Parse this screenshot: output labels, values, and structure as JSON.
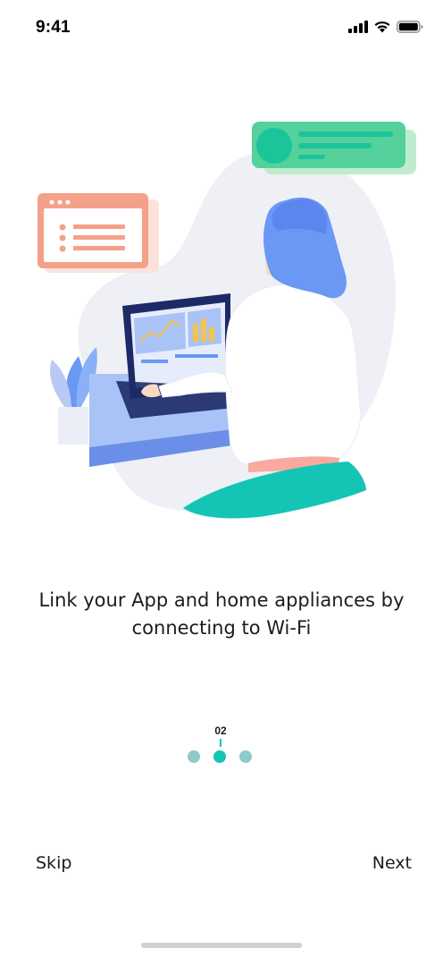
{
  "status_bar": {
    "time": "9:41",
    "icons": [
      "signal-bars-icon",
      "wifi-icon",
      "battery-icon"
    ]
  },
  "illustration": {
    "subject": "onboarding-illustration",
    "colors": {
      "blob": "#eef0f5",
      "accent": "#14c4b4",
      "card_green": "#55d19b",
      "window_salmon": "#f5a089",
      "hair_blue": "#6b97f5",
      "desk_blue": "#a9c3f7"
    }
  },
  "onboarding": {
    "caption_line1": "Link your App and home appliances by",
    "caption_line2": "connecting to Wi-Fi",
    "page_number": "02",
    "current_page": 2,
    "total_pages": 3
  },
  "actions": {
    "skip_label": "Skip",
    "next_label": "Next"
  },
  "colors": {
    "accent": "#14c4b4",
    "dot_inactive": "#8ecac9",
    "text": "#1c1c1c"
  }
}
